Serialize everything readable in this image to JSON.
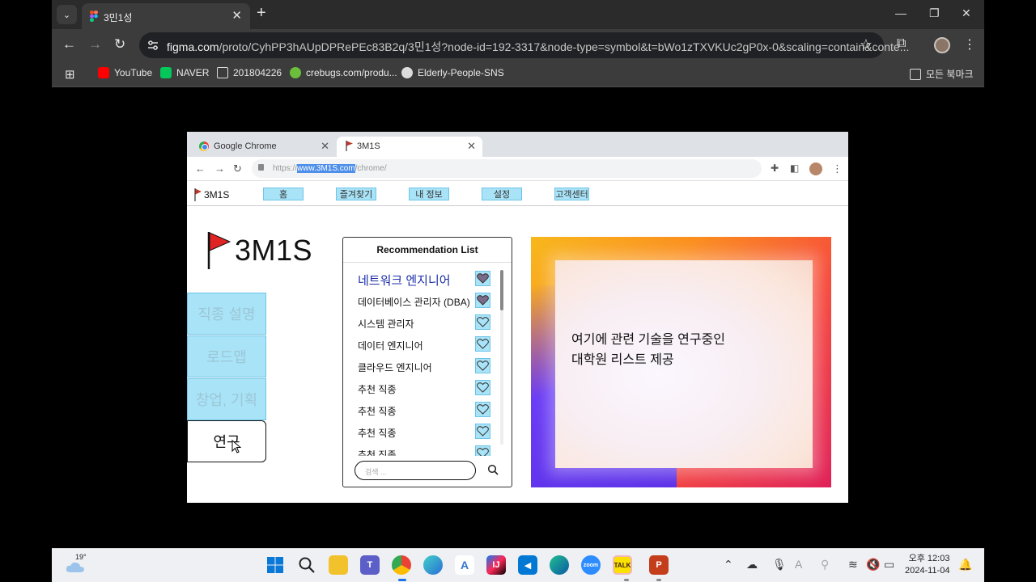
{
  "outer_browser": {
    "tab_title": "3민1성",
    "url_domain": "figma.com",
    "url_rest": "/proto/CyhPP3hAUpDPRePEc83B2q/3민1성?node-id=192-3317&node-type=symbol&t=bWo1zTXVKUc2gP0x-0&scaling=contain&conte...",
    "bookmarks": [
      "YouTube",
      "NAVER",
      "201804226",
      "crebugs.com/produ...",
      "Elderly-People-SNS"
    ],
    "all_bookmarks": "모든 북마크"
  },
  "inner_browser": {
    "tabs": [
      "Google Chrome",
      "3M1S"
    ],
    "url_prefix": "https://",
    "url_host": "www.3M1S.com",
    "url_path": "/chrome/"
  },
  "site": {
    "brand": "3M1S",
    "nav": [
      "홈",
      "즐겨찾기",
      "내 정보",
      "설정",
      "고객센터"
    ],
    "logo_text": "3M1S",
    "side_menu": [
      "직종 설명",
      "로드맵",
      "창업, 기획",
      "연구"
    ]
  },
  "recommendation": {
    "title": "Recommendation List",
    "items": [
      {
        "label": "네트워크 엔지니어",
        "favorited": true
      },
      {
        "label": "데이터베이스 관리자 (DBA)",
        "favorited": true
      },
      {
        "label": "시스템 관리자",
        "favorited": false
      },
      {
        "label": "데이터 엔지니어",
        "favorited": false
      },
      {
        "label": "클라우드 엔지니어",
        "favorited": false
      },
      {
        "label": "추천 직종",
        "favorited": false
      },
      {
        "label": "추천 직종",
        "favorited": false
      },
      {
        "label": "추천 직종",
        "favorited": false
      },
      {
        "label": "추천 직종",
        "favorited": false
      }
    ],
    "search_placeholder": "검색 ..."
  },
  "info_card": {
    "line1": "여기에 관련 기술을 연구중인",
    "line2": "대학원 리스트 제공"
  },
  "taskbar": {
    "weather": "19°",
    "time": "오후 12:03",
    "date": "2024-11-04"
  },
  "colors": {
    "nav_button": "#a9e3f7",
    "accent_blue": "#1d2fa8",
    "heart_fill": "#7b6b8a"
  }
}
